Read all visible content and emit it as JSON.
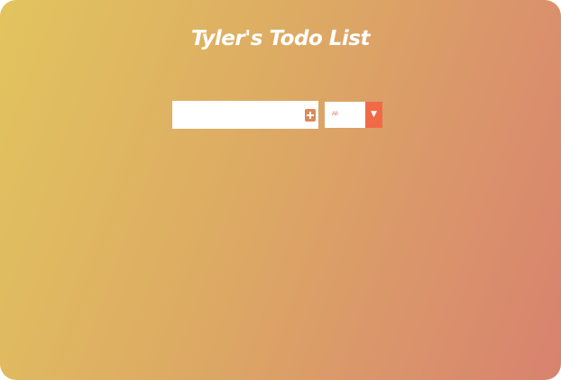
{
  "app": {
    "title": "Tyler's Todo List"
  },
  "form": {
    "input_value": "",
    "input_placeholder": "",
    "add_icon": "plus-square-icon",
    "filter": {
      "selected": "All",
      "arrow": "▼",
      "arrow_icon": "caret-down-icon"
    }
  },
  "colors": {
    "gradient_start": "#e2c45e",
    "gradient_end": "#d8826e",
    "filter_arrow_bg": "#f16a46",
    "add_button_bg": "#d98a5e",
    "filter_text": "#d96a4a"
  }
}
